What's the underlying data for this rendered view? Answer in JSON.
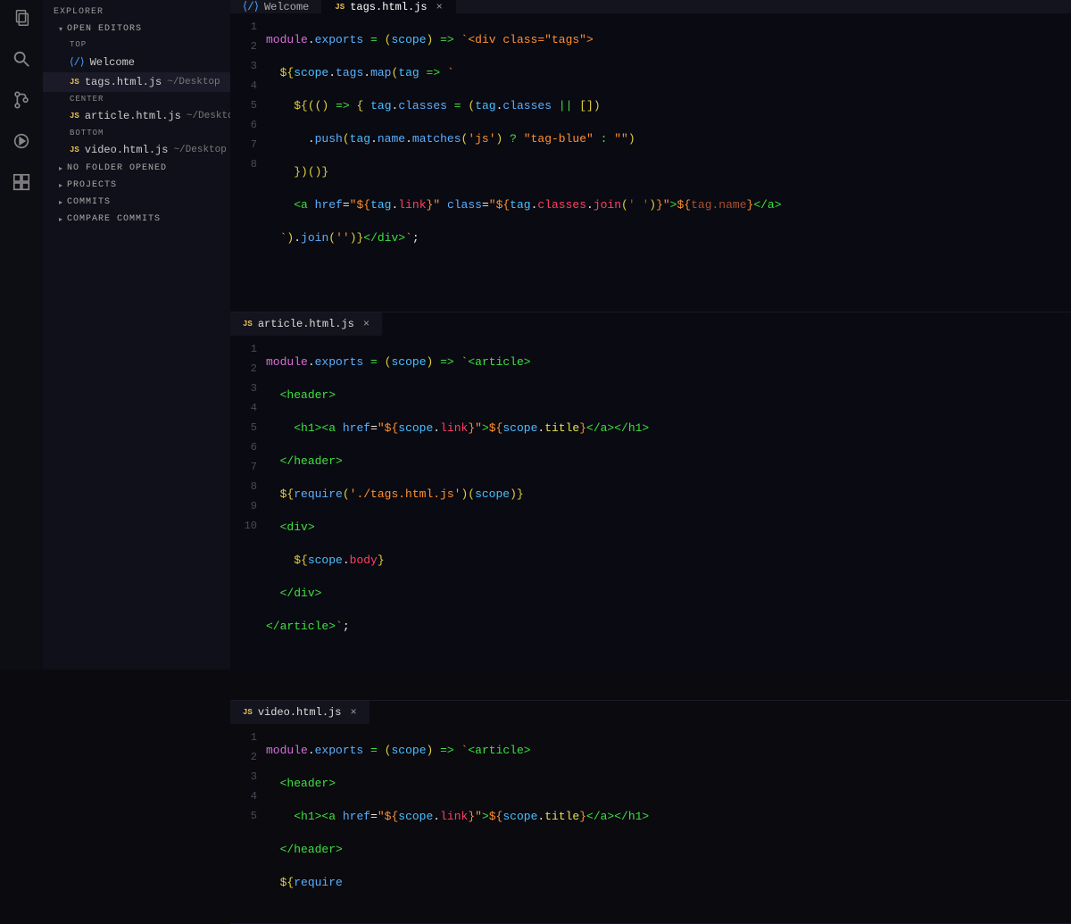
{
  "activity_bar": {
    "icons": [
      "files-icon",
      "search-icon",
      "source-control-icon",
      "debug-icon",
      "extensions-icon"
    ]
  },
  "sidebar": {
    "title": "EXPLORER",
    "sections": {
      "open_editors": {
        "label": "OPEN EDITORS",
        "groups": [
          {
            "label": "TOP",
            "items": [
              {
                "icon": "vscode",
                "name": "Welcome",
                "path": ""
              },
              {
                "icon": "js",
                "name": "tags.html.js",
                "path": "~/Desktop"
              }
            ]
          },
          {
            "label": "CENTER",
            "items": [
              {
                "icon": "js",
                "name": "article.html.js",
                "path": "~/Desktop"
              }
            ]
          },
          {
            "label": "BOTTOM",
            "items": [
              {
                "icon": "js",
                "name": "video.html.js",
                "path": "~/Desktop"
              }
            ]
          }
        ]
      },
      "no_folder": "NO FOLDER OPENED",
      "projects": "PROJECTS",
      "commits": "COMMITS",
      "compare_commits": "COMPARE COMMITS"
    }
  },
  "top_tabs": [
    {
      "icon": "vscode",
      "label": "Welcome",
      "active": false
    },
    {
      "icon": "js",
      "label": "tags.html.js",
      "active": true
    }
  ],
  "panes": [
    {
      "tab": {
        "icon": "js",
        "label": "tags.html.js"
      },
      "lines": [
        "module.exports = (scope) => `<div class=\"tags\">",
        "  ${scope.tags.map(tag => `",
        "    ${(() => { tag.classes = (tag.classes || [])",
        "      .push(tag.name.matches('js') ? \"tag-blue\" : \"\")",
        "    })()}",
        "    <a href=\"${tag.link}\" class=\"${tag.classes.join(' ')}\">${tag.name}</a>",
        "  `).join('')}</div>`;",
        ""
      ],
      "line_count": 8
    },
    {
      "tab": {
        "icon": "js",
        "label": "article.html.js"
      },
      "lines": [
        "module.exports = (scope) => `<article>",
        "  <header>",
        "    <h1><a href=\"${scope.link}\">${scope.title}</a></h1>",
        "  </header>",
        "  ${require('./tags.html.js')(scope)}",
        "  <div>",
        "    ${scope.body}",
        "  </div>",
        "</article>`;",
        ""
      ],
      "line_count": 10
    },
    {
      "tab": {
        "icon": "js",
        "label": "video.html.js"
      },
      "lines": [
        "module.exports = (scope) => `<article>",
        "  <header>",
        "    <h1><a href=\"${scope.link}\">${scope.title}</a></h1>",
        "  </header>",
        "  ${require"
      ],
      "line_count": 5
    }
  ]
}
